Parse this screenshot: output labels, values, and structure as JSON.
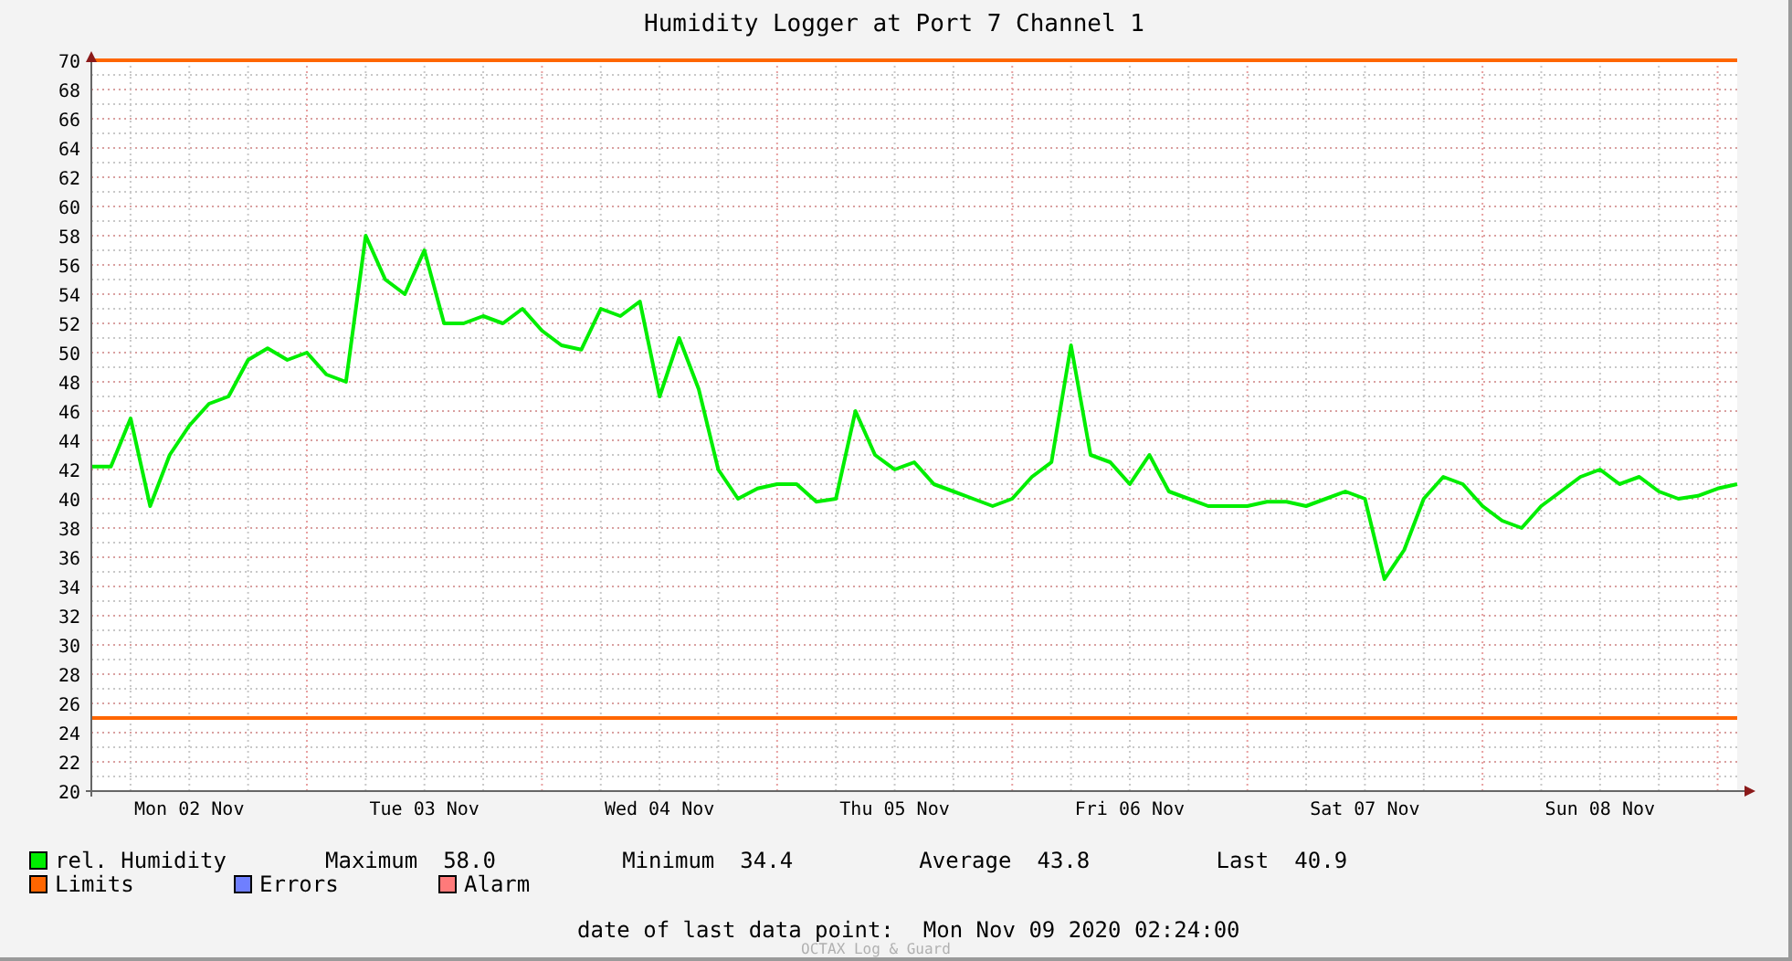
{
  "chart": {
    "chart_data": {
      "type": "line",
      "title": "Humidity Logger at Port 7 Channel 1",
      "categories": [
        null,
        null,
        null,
        null,
        null,
        "Mon 02 Nov",
        null,
        null,
        null,
        null,
        null,
        null,
        null,
        null,
        null,
        null,
        null,
        "Tue 03 Nov",
        null,
        null,
        null,
        null,
        null,
        null,
        null,
        null,
        null,
        null,
        null,
        "Wed 04 Nov",
        null,
        null,
        null,
        null,
        null,
        null,
        null,
        null,
        null,
        null,
        null,
        "Thu 05 Nov",
        null,
        null,
        null,
        null,
        null,
        null,
        null,
        null,
        null,
        null,
        null,
        "Fri 06 Nov",
        null,
        null,
        null,
        null,
        null,
        null,
        null,
        null,
        null,
        null,
        null,
        "Sat 07 Nov",
        null,
        null,
        null,
        null,
        null,
        null,
        null,
        null,
        null,
        null,
        null,
        "Sun 08 Nov",
        null,
        null,
        null,
        null,
        null,
        null,
        null
      ],
      "series": [
        {
          "name": "rel. Humidity",
          "color": "#00ee00",
          "values": [
            42.2,
            42.2,
            45.5,
            39.5,
            43,
            45,
            46.5,
            47,
            49.5,
            50.3,
            49.5,
            50,
            48.5,
            48,
            58,
            55,
            54,
            57,
            52,
            52,
            52.5,
            52,
            53,
            51.5,
            50.5,
            50.2,
            53,
            52.5,
            53.5,
            47,
            51,
            47.5,
            42,
            40,
            40.7,
            41,
            41,
            39.8,
            40,
            46,
            43,
            42,
            42.5,
            41,
            40.5,
            40,
            39.5,
            40,
            41.5,
            42.5,
            50.5,
            43,
            42.5,
            41,
            43,
            40.5,
            40,
            39.5,
            39.5,
            39.5,
            39.8,
            39.8,
            39.5,
            40,
            40.5,
            40,
            34.5,
            36.5,
            40,
            41.5,
            41,
            39.5,
            38.5,
            38,
            39.5,
            40.5,
            41.5,
            42,
            41,
            41.5,
            40.5,
            40,
            40.2,
            40.7,
            41
          ]
        },
        {
          "name": "Limits",
          "color": "#ff6600",
          "values": [
            70,
            70,
            70,
            70,
            70,
            70,
            70,
            70,
            70,
            70,
            70,
            70,
            70,
            70,
            70,
            70,
            70,
            70,
            70,
            70,
            70,
            70,
            70,
            70,
            70,
            70,
            70,
            70,
            70,
            70,
            70,
            70,
            70,
            70,
            70,
            70,
            70,
            70,
            70,
            70,
            70,
            70,
            70,
            70,
            70,
            70,
            70,
            70,
            70,
            70,
            70,
            70,
            70,
            70,
            70,
            70,
            70,
            70,
            70,
            70,
            70,
            70,
            70,
            70,
            70,
            70,
            70,
            70,
            70,
            70,
            70,
            70,
            70,
            70,
            70,
            70,
            70,
            70,
            70,
            70,
            70,
            70,
            70,
            70,
            70
          ]
        },
        {
          "color": "#ff6600",
          "values": [
            25,
            25,
            25,
            25,
            25,
            25,
            25,
            25,
            25,
            25,
            25,
            25,
            25,
            25,
            25,
            25,
            25,
            25,
            25,
            25,
            25,
            25,
            25,
            25,
            25,
            25,
            25,
            25,
            25,
            25,
            25,
            25,
            25,
            25,
            25,
            25,
            25,
            25,
            25,
            25,
            25,
            25,
            25,
            25,
            25,
            25,
            25,
            25,
            25,
            25,
            25,
            25,
            25,
            25,
            25,
            25,
            25,
            25,
            25,
            25,
            25,
            25,
            25,
            25,
            25,
            25,
            25,
            25,
            25,
            25,
            25,
            25,
            25,
            25,
            25,
            25,
            25,
            25,
            25,
            25,
            25,
            25,
            25,
            25,
            25
          ]
        }
      ],
      "grid": true,
      "ylim": [
        20,
        70
      ],
      "yticks": [
        20,
        22,
        24,
        26,
        28,
        30,
        32,
        34,
        36,
        38,
        40,
        42,
        44,
        46,
        48,
        50,
        52,
        54,
        56,
        58,
        60,
        62,
        64,
        66,
        68,
        70
      ],
      "ylabel": null
    }
  },
  "stats": [
    {
      "label": "Maximum",
      "value": "58.0"
    },
    {
      "label": "Minimum",
      "value": "34.4"
    },
    {
      "label": "Average",
      "value": "43.8"
    },
    {
      "label": "Last",
      "value": "40.9"
    }
  ],
  "legend": [
    {
      "label": "Errors",
      "color": "#6f7fff"
    },
    {
      "label": "Alarm",
      "color": "#ff7a7a"
    }
  ],
  "last_data_point": {
    "label": "date of last data point:",
    "value": "Mon Nov 09 2020 02:24:00"
  },
  "footer": "OCTAX Log & Guard"
}
